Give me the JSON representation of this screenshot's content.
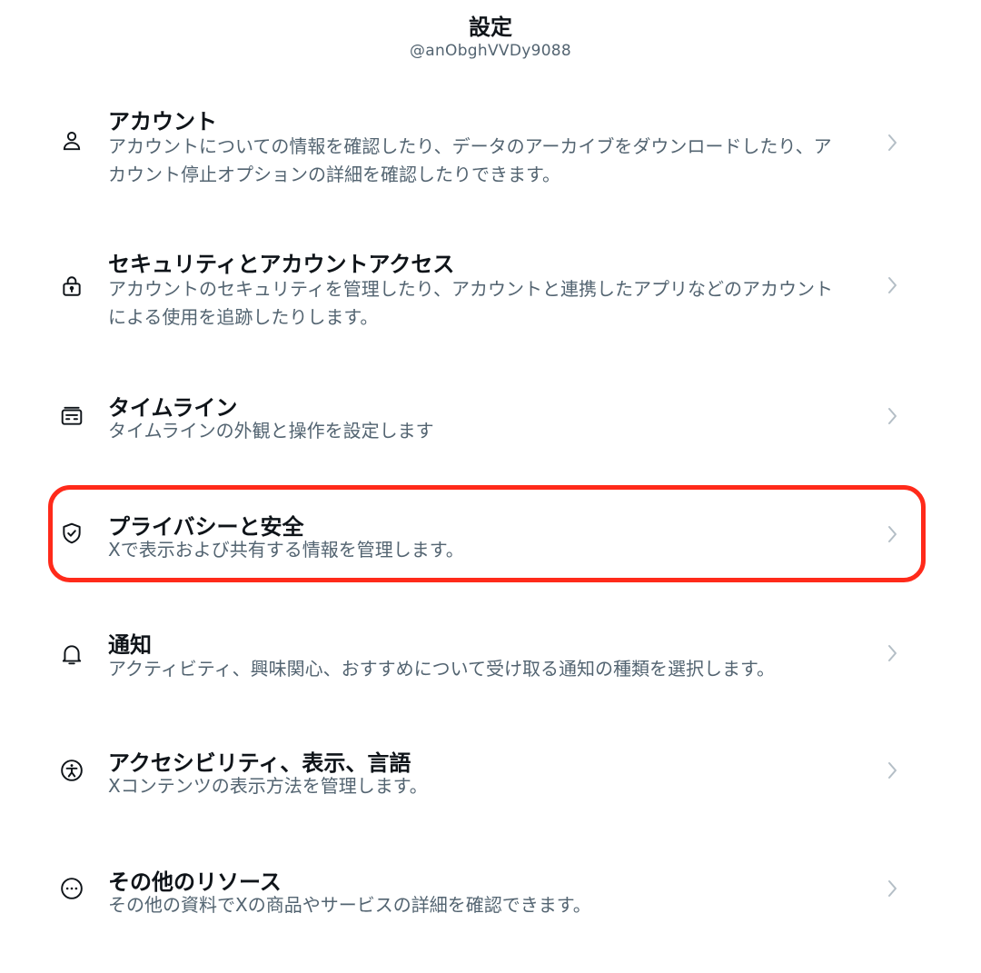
{
  "header": {
    "title": "設定",
    "handle": "@anObghVVDy9088"
  },
  "settings": [
    {
      "icon": "user-icon",
      "label": "アカウント",
      "description": "アカウントについての情報を確認したり、データのアーカイブをダウンロードしたり、アカウント停止オプションの詳細を確認したりできます。"
    },
    {
      "icon": "lock-icon",
      "label": "セキュリティとアカウントアクセス",
      "description": "アカウントのセキュリティを管理したり、アカウントと連携したアプリなどのアカウントによる使用を追跡したりします。"
    },
    {
      "icon": "timeline-icon",
      "label": "タイムライン",
      "description": "タイムラインの外観と操作を設定します"
    },
    {
      "icon": "shield-check-icon",
      "label": "プライバシーと安全",
      "description": "Xで表示および共有する情報を管理します。"
    },
    {
      "icon": "bell-icon",
      "label": "通知",
      "description": "アクティビティ、興味関心、おすすめについて受け取る通知の種類を選択します。"
    },
    {
      "icon": "accessibility-icon",
      "label": "アクセシビリティ、表示、言語",
      "description": "Xコンテンツの表示方法を管理します。"
    },
    {
      "icon": "more-icon",
      "label": "その他のリソース",
      "description": "その他の資料でXの商品やサービスの詳細を確認できます。"
    }
  ],
  "colors": {
    "text_primary": "#0f1419",
    "text_secondary": "#536471",
    "highlight_border": "#ff2a1a"
  }
}
